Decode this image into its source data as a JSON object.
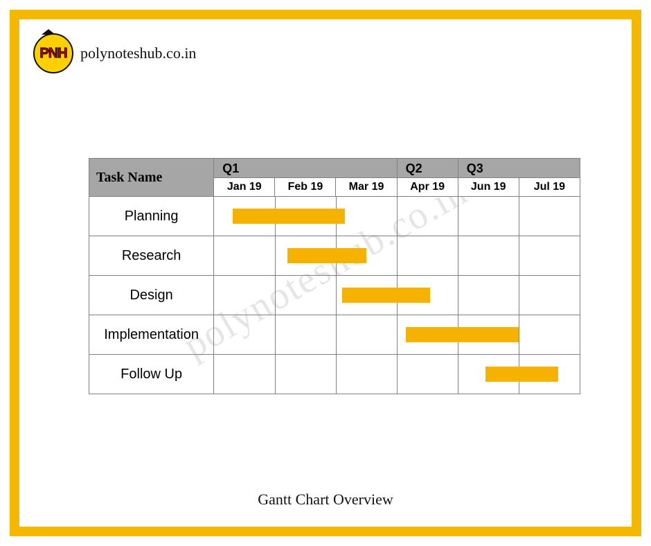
{
  "site_title": "polynoteshub.co.in",
  "logo_abbrev": "PNH",
  "watermark": "polynoteshub.co.in",
  "caption": "Gantt Chart Overview",
  "gantt": {
    "task_header": "Task Name",
    "quarters": [
      {
        "label": "Q1",
        "span": 3
      },
      {
        "label": "Q2",
        "span": 1
      },
      {
        "label": "Q3",
        "span": 2
      }
    ],
    "months": [
      "Jan 19",
      "Feb 19",
      "Mar 19",
      "Apr 19",
      "Jun 19",
      "Jul 19"
    ]
  },
  "chart_data": {
    "type": "gantt",
    "title": "Gantt Chart Overview",
    "time_axis": [
      "Jan 19",
      "Feb 19",
      "Mar 19",
      "Apr 19",
      "Jun 19",
      "Jul 19"
    ],
    "time_groups": {
      "Q1": [
        "Jan 19",
        "Feb 19",
        "Mar 19"
      ],
      "Q2": [
        "Apr 19"
      ],
      "Q3": [
        "Jun 19",
        "Jul 19"
      ]
    },
    "tasks": [
      {
        "name": "Planning",
        "start_index": 0.3,
        "end_index": 2.15
      },
      {
        "name": "Research",
        "start_index": 1.2,
        "end_index": 2.5
      },
      {
        "name": "Design",
        "start_index": 2.1,
        "end_index": 3.55
      },
      {
        "name": "Implementation",
        "start_index": 3.15,
        "end_index": 5.0
      },
      {
        "name": "Follow Up",
        "start_index": 4.45,
        "end_index": 5.65
      }
    ],
    "bar_color": "#f5b200",
    "axis_range": [
      0,
      6
    ],
    "note": "start_index/end_index are in month-column units along time_axis (0 = start of Jan 19 column, 6 = end of Jul 19 column)."
  }
}
